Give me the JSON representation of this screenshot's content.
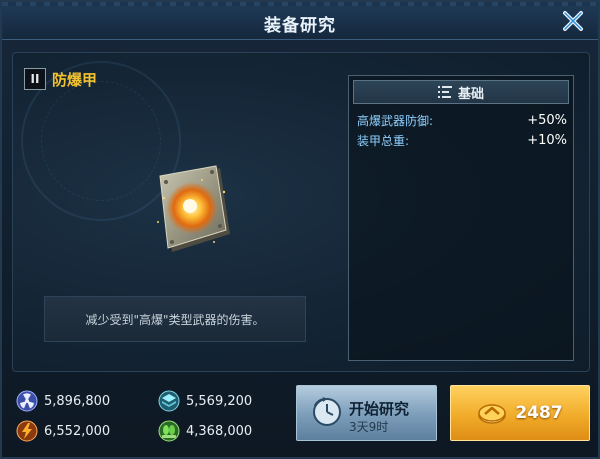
{
  "window": {
    "title": "装备研究"
  },
  "item": {
    "tier": "II",
    "name": "防爆甲",
    "description": "减少受到\"高爆\"类型武器的伤害。"
  },
  "stats": {
    "header_label": "基础",
    "rows": [
      {
        "name": "高爆武器防御:",
        "value": "+50%"
      },
      {
        "name": "装甲总重:",
        "value": "+10%"
      }
    ]
  },
  "resources": [
    {
      "icon": "radiation-icon",
      "value": "5,896,800",
      "color": "#6e8cff"
    },
    {
      "icon": "stack-layers-icon",
      "value": "5,569,200",
      "color": "#3fb7c9"
    },
    {
      "icon": "lightning-icon",
      "value": "6,552,000",
      "color": "#ff8a1e"
    },
    {
      "icon": "plant-icon",
      "value": "4,368,000",
      "color": "#6bcf4a"
    }
  ],
  "actions": {
    "start_label": "开始研究",
    "start_time": "3天9时",
    "gold_cost": "2487"
  },
  "colors": {
    "item_name": "#f2c230",
    "stat_name": "#8fd0ff",
    "gold_button": "#f1ac2a",
    "start_button": "#7fa0bc"
  }
}
